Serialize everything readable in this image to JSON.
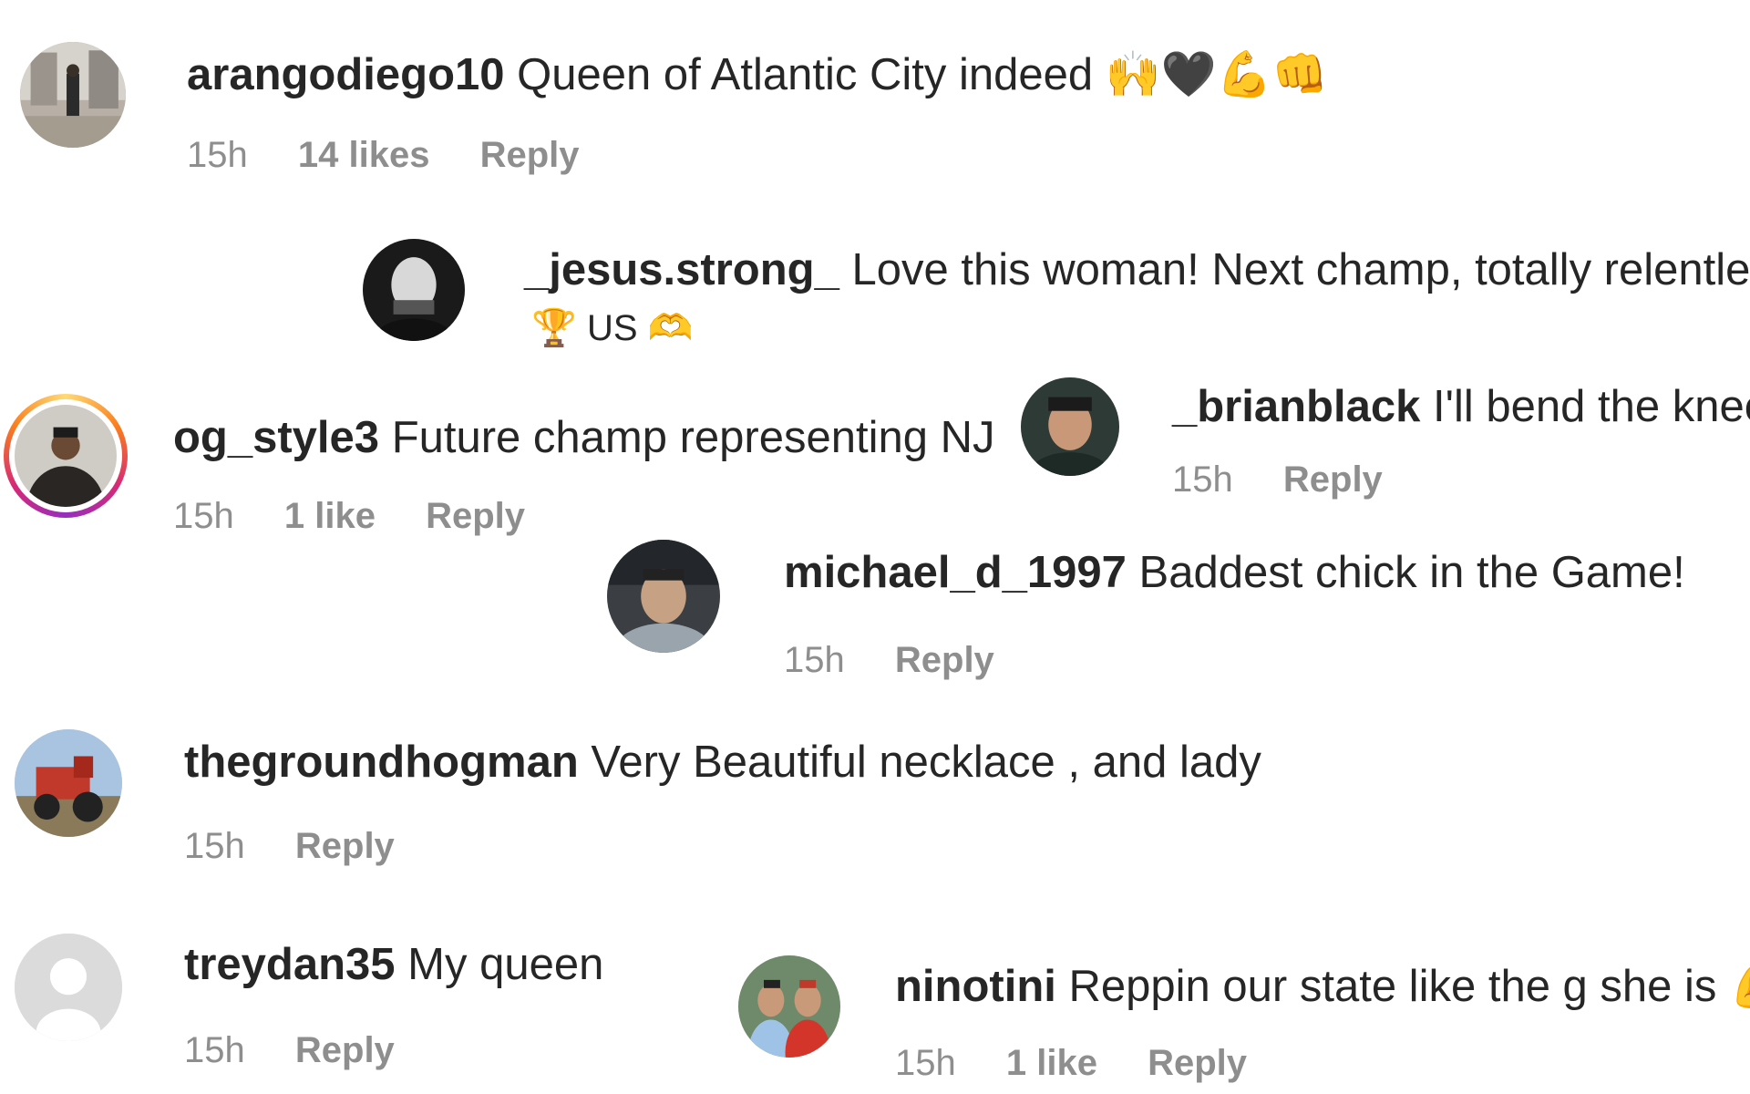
{
  "comments": [
    {
      "username": "arangodiego10",
      "text": "Queen of Atlantic City indeed",
      "emoji": "🙌🖤💪👊",
      "time": "15h",
      "likes": "14 likes",
      "reply": "Reply"
    },
    {
      "username": "_jesus.strong_",
      "text": "Love this woman! Next champ, totally relentless.",
      "text2_prefix": "🏆",
      "text2": "US",
      "text2_suffix": "🫶"
    },
    {
      "username": "og_style3",
      "text": "Future champ representing NJ",
      "time": "15h",
      "likes": "1 like",
      "reply": "Reply"
    },
    {
      "username": "_brianblack",
      "text": "I'll bend the knee",
      "time": "15h",
      "reply": "Reply"
    },
    {
      "username": "michael_d_1997",
      "text": "Baddest chick in the Game!",
      "time": "15h",
      "reply": "Reply"
    },
    {
      "username": "thegroundhogman",
      "text": "Very Beautiful necklace , and lady",
      "time": "15h",
      "reply": "Reply"
    },
    {
      "username": "treydan35",
      "text": "My queen",
      "time": "15h",
      "reply": "Reply"
    },
    {
      "username": "ninotini",
      "text": "Reppin our state like the g she is",
      "emoji": "💪",
      "time": "15h",
      "likes": "1 like",
      "reply": "Reply"
    }
  ],
  "colors": {
    "text": "#262626",
    "meta": "#8e8e8e",
    "background": "#ffffff"
  }
}
